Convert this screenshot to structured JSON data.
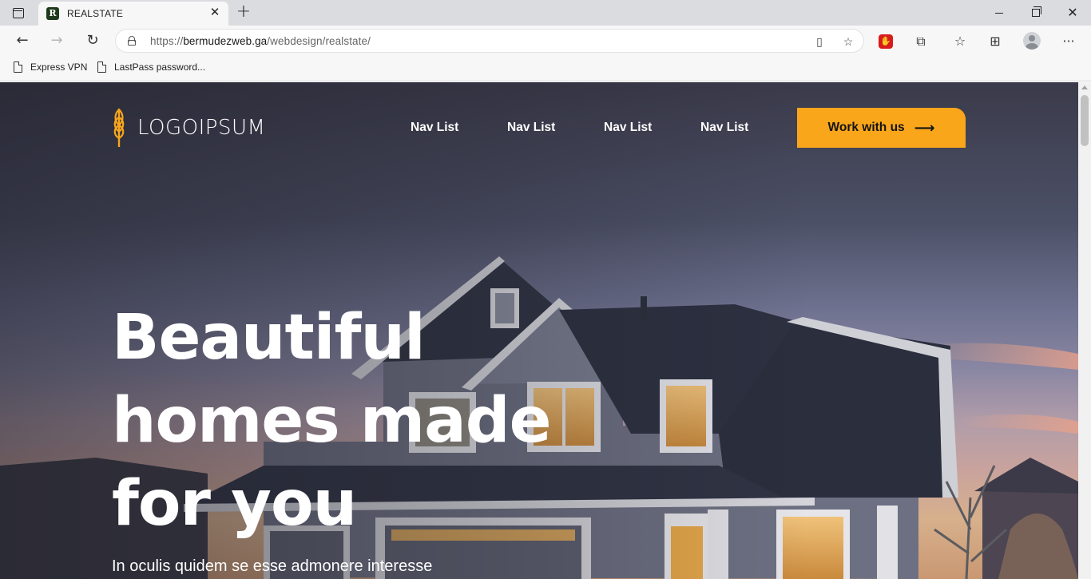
{
  "browser": {
    "tab_title": "REALSTATE",
    "favicon_letter": "R",
    "url_prefix": "https://",
    "url_host": "bermudezweb.ga",
    "url_path": "/webdesign/realstate/",
    "bookmarks": [
      {
        "label": "Express VPN"
      },
      {
        "label": "LastPass password..."
      }
    ],
    "icons": {
      "back": "arrow-left-icon",
      "forward": "arrow-right-icon",
      "refresh": "refresh-icon",
      "lock": "lock-icon",
      "reader": "reader-mode-icon",
      "favorite": "add-favorite-icon",
      "extensions": "extensions-icon",
      "favorites": "favorites-icon",
      "collections": "collections-icon",
      "menu": "more-icon"
    }
  },
  "site": {
    "logo_text": "LOGOIPSUM",
    "nav": [
      {
        "label": "Nav List"
      },
      {
        "label": "Nav List"
      },
      {
        "label": "Nav List"
      },
      {
        "label": "Nav List"
      }
    ],
    "cta_label": "Work with us",
    "hero": {
      "headline_lines": [
        "Beautiful",
        "homes made",
        "for you"
      ],
      "subline": "In oculis quidem se esse admonere interesse"
    },
    "colors": {
      "accent": "#f9a61a",
      "text": "#ffffff"
    }
  }
}
